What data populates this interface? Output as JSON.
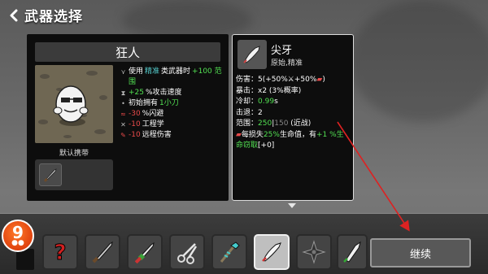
{
  "header": {
    "title": "武器选择"
  },
  "character": {
    "name": "狂人",
    "stats": [
      {
        "icon": "precision-icon",
        "segments": [
          {
            "text": "使用",
            "color": "white"
          },
          {
            "text": "精准",
            "color": "cyan"
          },
          {
            "text": "类武器时",
            "color": "white"
          },
          {
            "text": "+100 范",
            "color": "green"
          }
        ]
      },
      {
        "icon": "",
        "segments": [
          {
            "text": "围",
            "color": "green"
          }
        ]
      },
      {
        "icon": "hourglass-icon",
        "segments": [
          {
            "text": "+25",
            "color": "green"
          },
          {
            "text": " %攻击速度",
            "color": "white"
          }
        ]
      },
      {
        "icon": "dot-icon",
        "segments": [
          {
            "text": "初始拥有",
            "color": "white"
          },
          {
            "text": "1小刀",
            "color": "green"
          }
        ]
      },
      {
        "icon": "dodge-icon",
        "segments": [
          {
            "text": "-30",
            "color": "red"
          },
          {
            "text": " %闪避",
            "color": "white"
          }
        ]
      },
      {
        "icon": "wrench-icon",
        "segments": [
          {
            "text": "-10",
            "color": "red"
          },
          {
            "text": " 工程学",
            "color": "white"
          }
        ]
      },
      {
        "icon": "ranged-icon",
        "segments": [
          {
            "text": "-10",
            "color": "red"
          },
          {
            "text": " 远程伤害",
            "color": "white"
          }
        ]
      }
    ],
    "default_carry_label": "默认携带"
  },
  "weapon": {
    "name": "尖牙",
    "tags": "原始,精准",
    "lines": [
      {
        "segments": [
          {
            "text": "伤害：5(+50%",
            "color": "white"
          },
          {
            "text": "⚔",
            "color": "white"
          },
          {
            "text": "+50%",
            "color": "white"
          },
          {
            "text": "▰",
            "color": "red"
          },
          {
            "text": ")",
            "color": "white"
          }
        ]
      },
      {
        "segments": [
          {
            "text": "暴击：x2 (3%概率)",
            "color": "white"
          }
        ]
      },
      {
        "segments": [
          {
            "text": "冷却：",
            "color": "white"
          },
          {
            "text": "0.99",
            "color": "green"
          },
          {
            "text": "s",
            "color": "white"
          }
        ]
      },
      {
        "segments": [
          {
            "text": "击退：2",
            "color": "white"
          }
        ]
      },
      {
        "segments": [
          {
            "text": "范围：",
            "color": "white"
          },
          {
            "text": "250",
            "color": "green"
          },
          {
            "text": "|",
            "color": "white"
          },
          {
            "text": "150",
            "color": "gray"
          },
          {
            "text": " (近战)",
            "color": "white"
          }
        ]
      },
      {
        "segments": [
          {
            "text": "▰",
            "color": "red"
          },
          {
            "text": "每损失",
            "color": "white"
          },
          {
            "text": "25%",
            "color": "green"
          },
          {
            "text": "生命值，有",
            "color": "white"
          },
          {
            "text": "+1 %生",
            "color": "green"
          }
        ]
      },
      {
        "segments": [
          {
            "text": "命窃取",
            "color": "green"
          },
          {
            "text": "[+0]",
            "color": "white"
          }
        ]
      }
    ]
  },
  "badge": {
    "number": "9",
    "pad_glyph": "🎮"
  },
  "weapon_slots": [
    {
      "icon": "random-question-icon"
    },
    {
      "icon": "knife-icon"
    },
    {
      "icon": "green-dagger-icon"
    },
    {
      "icon": "scissors-icon"
    },
    {
      "icon": "thorn-staff-icon"
    },
    {
      "icon": "fang-icon",
      "selected": true
    },
    {
      "icon": "shuriken-icon"
    },
    {
      "icon": "blade-icon"
    }
  ],
  "continue_label": "继续",
  "colors": {
    "green": "#52e052",
    "red": "#e84a4a",
    "cyan": "#55cccc",
    "accent_arrow": "#d22"
  }
}
